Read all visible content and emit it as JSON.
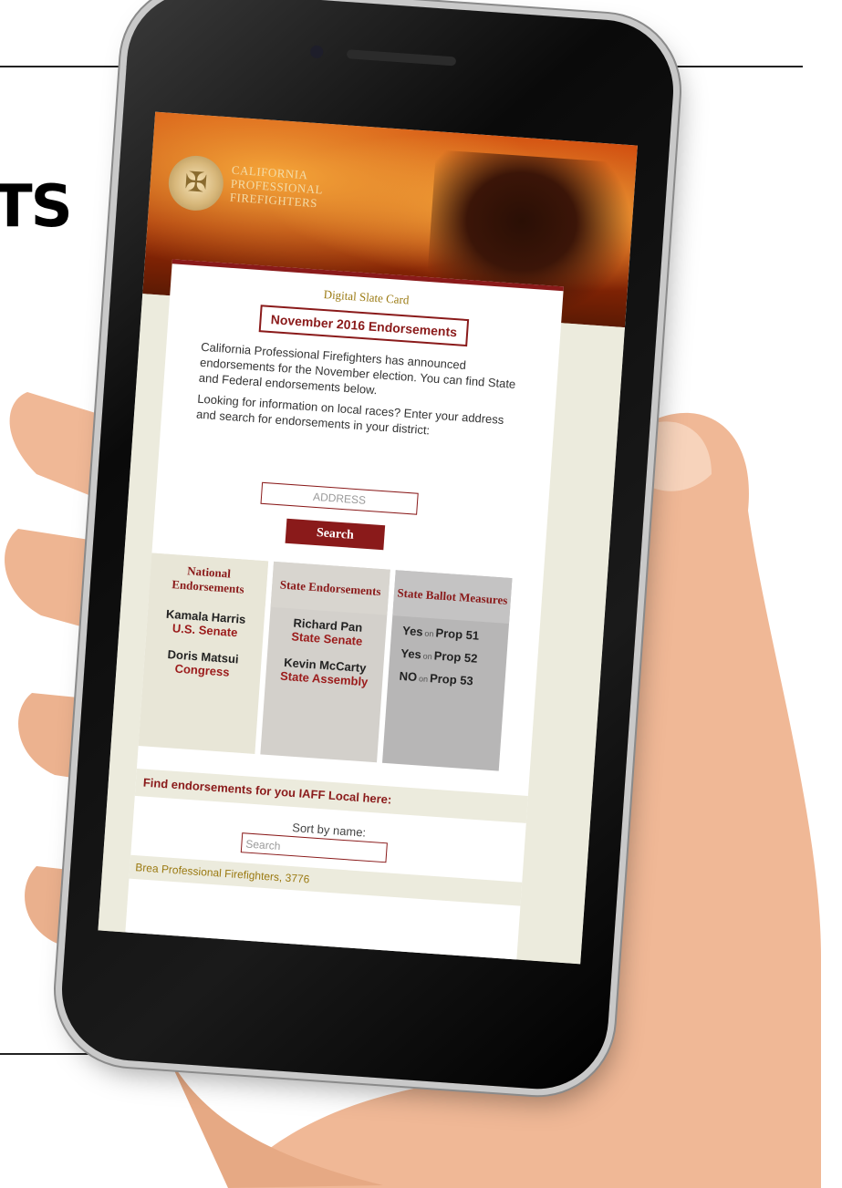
{
  "page": {
    "heading": "TS"
  },
  "logo": {
    "line1": "CALIFORNIA",
    "line2": "PROFESSIONAL",
    "line3": "FIREFIGHTERS"
  },
  "slate": {
    "subtitle": "Digital Slate Card",
    "title": "November 2016 Endorsements"
  },
  "intro": {
    "para1": "California Professional Firefighters has announced endorsements for the November election. You can find State and Federal endorsements below.",
    "para2": "Looking for information on local races? Enter your address and search for endorsements in your district:"
  },
  "address": {
    "placeholder": "ADDRESS"
  },
  "search": {
    "label": "Search"
  },
  "columns": {
    "national": {
      "title": "National Endorsements",
      "items": [
        {
          "name": "Kamala Harris",
          "office": "U.S. Senate"
        },
        {
          "name": "Doris Matsui",
          "office": "Congress"
        }
      ]
    },
    "state": {
      "title": "State Endorsements",
      "items": [
        {
          "name": "Richard Pan",
          "office": "State Senate"
        },
        {
          "name": "Kevin McCarty",
          "office": "State Assembly"
        }
      ]
    },
    "ballot": {
      "title": "State Ballot Measures",
      "items": [
        {
          "vote": "Yes",
          "on": "on",
          "prop": "Prop 51"
        },
        {
          "vote": "Yes",
          "on": "on",
          "prop": "Prop 52"
        },
        {
          "vote": "NO",
          "on": "on",
          "prop": "Prop 53"
        }
      ]
    }
  },
  "local": {
    "heading": "Find endorsements for you IAFF Local here:",
    "sort_label": "Sort by name:",
    "search_placeholder": "Search",
    "first_result": "Brea Professional Firefighters, 3776"
  }
}
